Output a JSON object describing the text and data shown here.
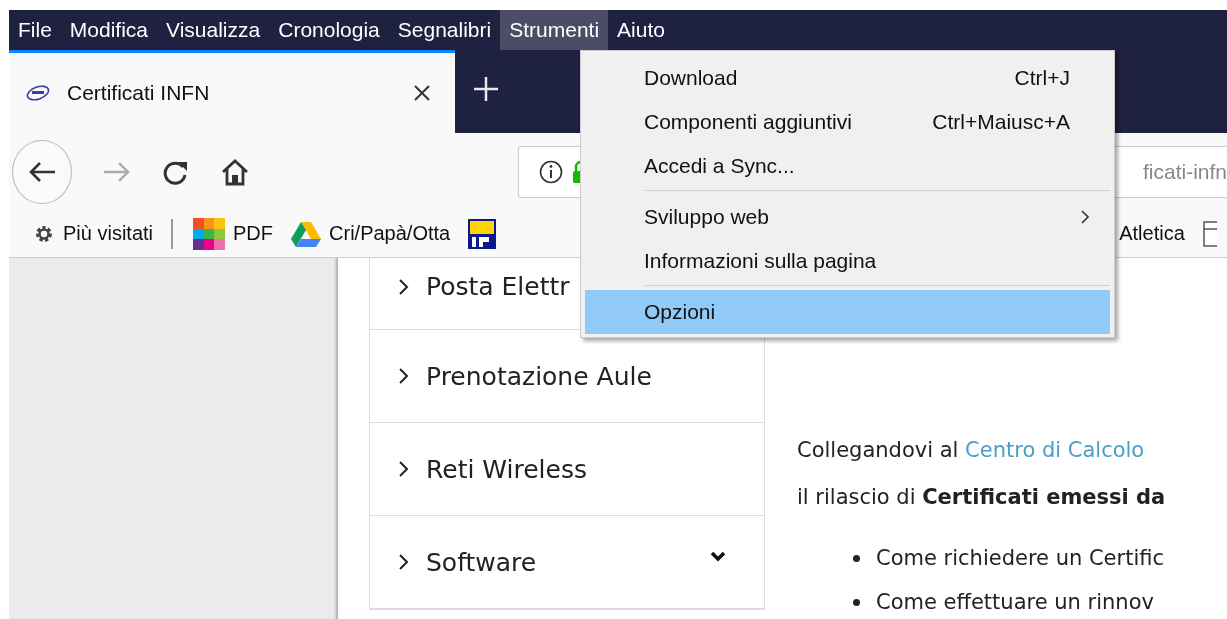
{
  "menubar": [
    {
      "label": "File",
      "selected": false
    },
    {
      "label": "Modifica",
      "selected": false
    },
    {
      "label": "Visualizza",
      "selected": false
    },
    {
      "label": "Cronologia",
      "selected": false
    },
    {
      "label": "Segnalibri",
      "selected": false
    },
    {
      "label": "Strumenti",
      "selected": true
    },
    {
      "label": "Aiuto",
      "selected": false
    }
  ],
  "tab": {
    "title": "Certificati INFN",
    "selected": true
  },
  "address_bar": {
    "value": "ficati-infn"
  },
  "bookmarks": [
    {
      "kind": "gear",
      "label": "Più visitati"
    },
    {
      "kind": "separator"
    },
    {
      "kind": "grid",
      "label": "PDF"
    },
    {
      "kind": "drive",
      "label": "Cri/Papà/Otta"
    },
    {
      "kind": "badge"
    },
    {
      "kind": "text",
      "label": "Atletica"
    },
    {
      "kind": "page"
    }
  ],
  "dropdown_menu": {
    "items": [
      {
        "kind": "item",
        "label": "Download",
        "shortcut": "Ctrl+J",
        "submenu": false,
        "selected": false
      },
      {
        "kind": "item",
        "label": "Componenti aggiuntivi",
        "shortcut": "Ctrl+Maiusc+A",
        "submenu": false,
        "selected": false
      },
      {
        "kind": "item",
        "label": "Accedi a Sync...",
        "submenu": false,
        "selected": false
      },
      {
        "kind": "separator"
      },
      {
        "kind": "item",
        "label": "Sviluppo web",
        "submenu": true,
        "selected": false
      },
      {
        "kind": "item",
        "label": "Informazioni sulla pagina",
        "submenu": false,
        "selected": false
      },
      {
        "kind": "separator"
      },
      {
        "kind": "item",
        "label": "Opzioni",
        "submenu": false,
        "selected": true
      }
    ]
  },
  "sidebar": {
    "items": [
      {
        "label": "Posta Elettr"
      },
      {
        "label": "Prenotazione Aule",
        "submenu": false
      },
      {
        "label": "Reti Wireless",
        "submenu": false
      },
      {
        "label": "Software",
        "submenu": true
      }
    ]
  },
  "content": {
    "lines": [
      {
        "text": "Collegandovi al ",
        "link": "Centro di Calcolo"
      },
      {
        "text": "il rilascio di **Certificati emessi da**"
      }
    ],
    "bullets": [
      "Come richiedere un Certific",
      "Come effettuare un rinnov"
    ]
  }
}
